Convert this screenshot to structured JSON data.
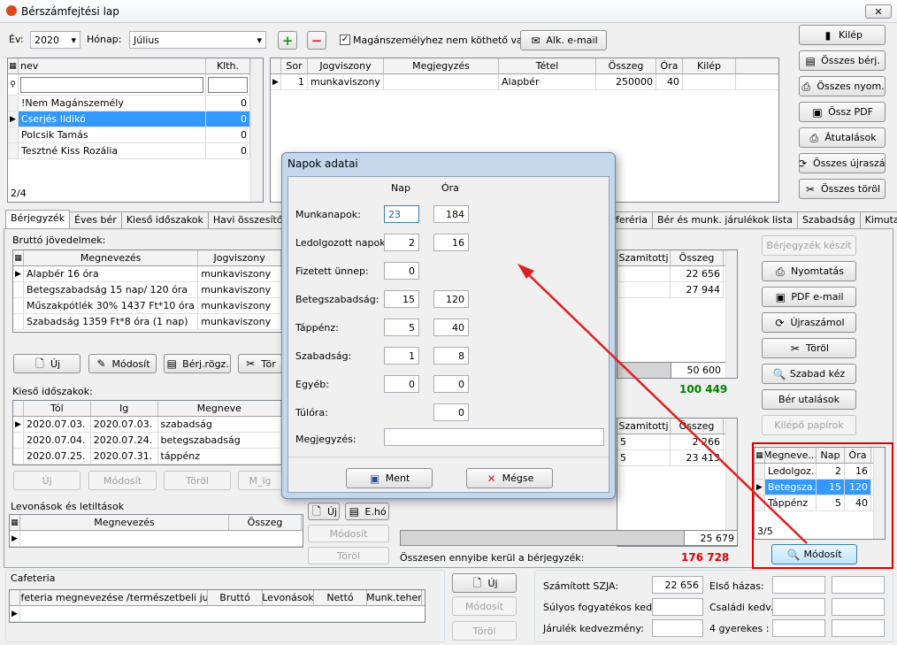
{
  "window": {
    "title": "Bérszámfejtési lap",
    "close": "✕"
  },
  "top": {
    "year_label": "Év:",
    "year": "2020",
    "month_label": "Hónap:",
    "month": "Július",
    "checkbox_label": "Magánszemélyhez nem köthető van",
    "email_btn": "Alk. e-mail"
  },
  "right_buttons": [
    "Kilép",
    "Összes bérj.",
    "Összes nyom.",
    "Össz PDF",
    "Átutalások",
    "Összes újraszá.",
    "Összes töröl"
  ],
  "people": {
    "col_name": "nev",
    "col_klth": "Klth.",
    "rows": [
      {
        "name": "!Nem Magánszemély",
        "k": "0"
      },
      {
        "name": "Cserjés Ildikó",
        "k": "0"
      },
      {
        "name": "Polcsik Tamás",
        "k": "0"
      },
      {
        "name": "Tesztné Kiss Rozália",
        "k": "0"
      }
    ],
    "footer": "2/4"
  },
  "contracts": {
    "cols": [
      "Sor",
      "Jogviszony",
      "Megjegyzés",
      "Tétel",
      "Összeg",
      "Óra",
      "Kilép"
    ],
    "row": [
      "1",
      "munkaviszony",
      "",
      "Alapbér",
      "250000",
      "40",
      ""
    ]
  },
  "tabs_left": [
    "Bérjegyzék",
    "Éves bér",
    "Kieső időszakok",
    "Havi összesítő",
    "Járu"
  ],
  "tabs_right": [
    "feréria",
    "Bér és munk. járulékok lista",
    "Szabadság",
    "Kimutatás"
  ],
  "brutto": {
    "label": "Bruttó jövedelmek:",
    "cols": [
      "Megnevezés",
      "Jogviszony"
    ],
    "rows": [
      [
        "Alapbér 16 óra",
        "munkaviszony"
      ],
      [
        "Betegszabadság 15 nap/ 120 óra",
        "munkaviszony"
      ],
      [
        "Műszakpótlék 30% 1437 Ft*10 óra",
        "munkaviszony"
      ],
      [
        "Szabadság 1359 Ft*8 óra (1 nap)",
        "munkaviszony"
      ]
    ],
    "right_cols": [
      "Szamitottj",
      "Összeg"
    ],
    "right_rows": [
      "22 656",
      "27 944"
    ],
    "total": "50 600",
    "grand": "100 449",
    "btn_new": "Új",
    "btn_mod": "Módosít",
    "btn_berj": "Bérj.rögz.",
    "btn_tor": "Tör"
  },
  "kieso": {
    "label": "Kieső időszakok:",
    "cols": [
      "Tól",
      "Ig",
      "Megneve"
    ],
    "rows": [
      [
        "2020.07.03.",
        "2020.07.03.",
        "szabadság"
      ],
      [
        "2020.07.04.",
        "2020.07.24.",
        "betegszabadság"
      ],
      [
        "2020.07.25.",
        "2020.07.31.",
        "táppénz"
      ]
    ],
    "right_cols": [
      "Szamitottj",
      "Összeg"
    ],
    "right_rows": [
      [
        "5",
        "2 266"
      ],
      [
        "5",
        "23 413"
      ]
    ],
    "total": "25 679",
    "btn_new": "Új",
    "btn_mod": "Módosít",
    "btn_del": "Töröl",
    "btn_mig": "M_ig"
  },
  "levon": {
    "label": "Levonások és letiltások",
    "cols": [
      "Megnevezés",
      "Összeg"
    ],
    "btn_new": "Új",
    "btn_eho": "E.hó",
    "btn_mod": "Módosít",
    "btn_del": "Töröl"
  },
  "sum": {
    "label": "Összesen ennyibe kerül a bérjegyzék:",
    "value": "176 728"
  },
  "actions": [
    "Bérjegyzék készít",
    "Nyomtatás",
    "PDF e-mail",
    "Újraszámol",
    "Töröl",
    "Szabad kéz",
    "Bér utalások",
    "Kilépő papírok"
  ],
  "mini": {
    "cols": [
      "Megneve...",
      "Nap",
      "Óra"
    ],
    "rows": [
      [
        "Ledolgoz...",
        "2",
        "16"
      ],
      [
        "Betegsza...",
        "15",
        "120"
      ],
      [
        "Táppénz",
        "5",
        "40"
      ]
    ],
    "footer": "3/5",
    "btn": "Módosít"
  },
  "cafeteria": {
    "label": "Cafeteria",
    "cols": [
      "Cafeteria megnevezése /természetbeli jutt/",
      "Bruttó",
      "Levonások",
      "Nettó",
      "Munk.teher"
    ],
    "btn_new": "Új",
    "btn_mod": "Módosít",
    "btn_del": "Töröl"
  },
  "bottom": {
    "szja_label": "Számított SZJA:",
    "szja": "22 656",
    "elso_label": "Első házas:",
    "sulyos_label": "Súlyos fogyatékos kedv.:",
    "csaladi_label": "Családi kedv.:",
    "jarulek_label": "Járulék kedvezmény:",
    "gyerek_label": "4 gyerekes :"
  },
  "dialog": {
    "title": "Napok adatai",
    "col_nap": "Nap",
    "col_ora": "Óra",
    "rows": [
      {
        "label": "Munkanapok:",
        "nap": "23",
        "ora": "184"
      },
      {
        "label": "Ledolgozott napok:",
        "nap": "2",
        "ora": "16"
      },
      {
        "label": "Fizetett ünnep:",
        "nap": "0",
        "ora": ""
      },
      {
        "label": "Betegszabadság:",
        "nap": "15",
        "ora": "120"
      },
      {
        "label": "Táppénz:",
        "nap": "5",
        "ora": "40"
      },
      {
        "label": "Szabadság:",
        "nap": "1",
        "ora": "8"
      },
      {
        "label": "Egyéb:",
        "nap": "0",
        "ora": "0"
      },
      {
        "label": "Túlóra:",
        "nap": "",
        "ora": "0"
      }
    ],
    "note_label": "Megjegyzés:",
    "save": "Ment",
    "cancel": "Mégse"
  },
  "colors": {
    "selection": "#3399ff",
    "accent_red": "#e00000",
    "green": "#008000",
    "arrow": "#e02020"
  }
}
